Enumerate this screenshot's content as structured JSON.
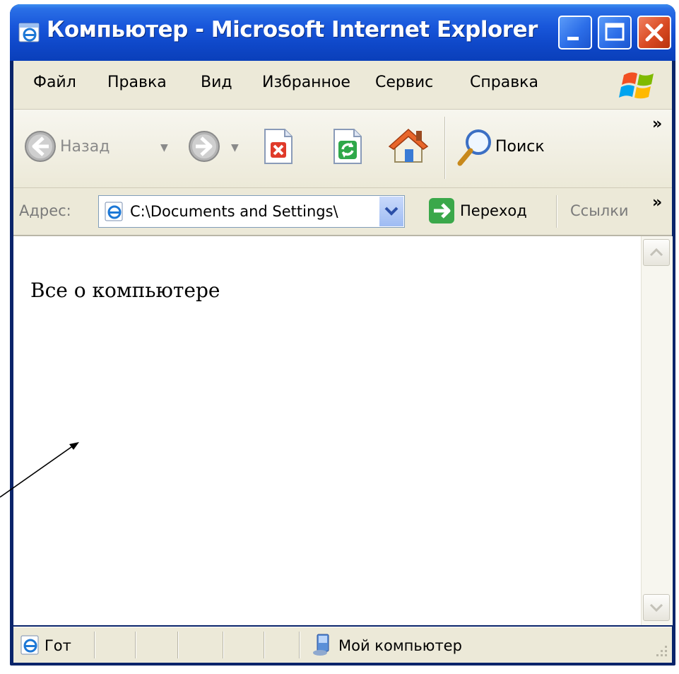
{
  "window": {
    "title": "Компьютер - Microsoft Internet Explorer"
  },
  "menu": {
    "items": [
      {
        "label": "Файл"
      },
      {
        "label": "Правка"
      },
      {
        "label": "Вид"
      },
      {
        "label": "Избранное"
      },
      {
        "label": "Сервис"
      },
      {
        "label": "Справка"
      }
    ]
  },
  "toolbar": {
    "back_label": "Назад",
    "search_label": "Поиск",
    "more_label": "»"
  },
  "address": {
    "label": "Адрес:",
    "value": "C:\\Documents and Settings\\",
    "go_label": "Переход",
    "links_label": "Ссылки",
    "more_label": "»"
  },
  "content": {
    "text": "Все о компьютере"
  },
  "status": {
    "text": "Гот",
    "zone_label": "Мой компьютер"
  },
  "icons": [
    "ie-icon",
    "minimize-icon",
    "maximize-icon",
    "close-icon",
    "windows-logo-icon",
    "back-icon",
    "forward-icon",
    "stop-icon",
    "refresh-icon",
    "home-icon",
    "search-icon",
    "go-icon",
    "computer-icon"
  ]
}
